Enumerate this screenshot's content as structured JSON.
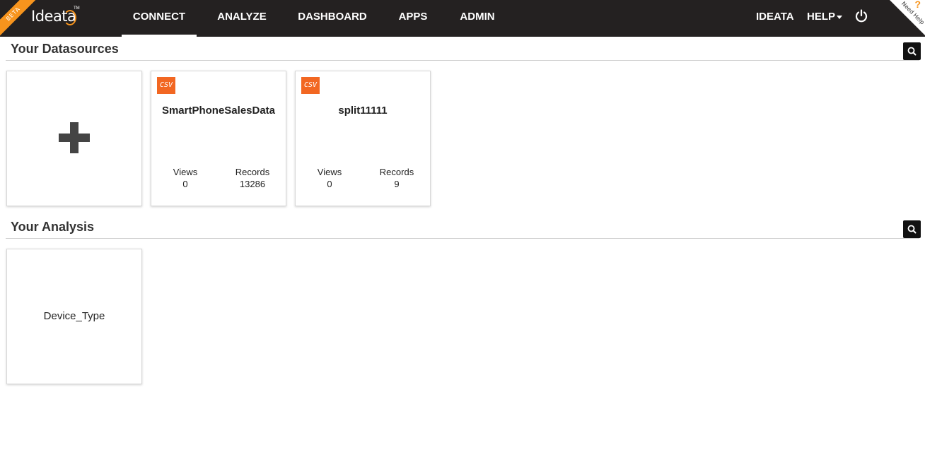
{
  "brand": {
    "logo_text": "Ideata",
    "trademark": "TM",
    "beta_label": "BETA",
    "accent_color": "#f7941d"
  },
  "nav": {
    "items": [
      {
        "label": "CONNECT",
        "active": true
      },
      {
        "label": "ANALYZE",
        "active": false
      },
      {
        "label": "DASHBOARD",
        "active": false
      },
      {
        "label": "APPS",
        "active": false
      },
      {
        "label": "ADMIN",
        "active": false
      }
    ],
    "user_label": "IDEATA",
    "help_label": "HELP",
    "need_help_label": "Need Help",
    "need_help_mark": "?"
  },
  "datasources": {
    "title": "Your Datasources",
    "add_icon": "plus-icon",
    "items": [
      {
        "name": "SmartPhoneSalesData",
        "type_badge": "CSV",
        "views_label": "Views",
        "views": "0",
        "records_label": "Records",
        "records": "13286"
      },
      {
        "name": "split11111",
        "type_badge": "CSV",
        "views_label": "Views",
        "views": "0",
        "records_label": "Records",
        "records": "9"
      }
    ]
  },
  "analysis": {
    "title": "Your Analysis",
    "items": [
      {
        "name": "Device_Type"
      }
    ]
  }
}
